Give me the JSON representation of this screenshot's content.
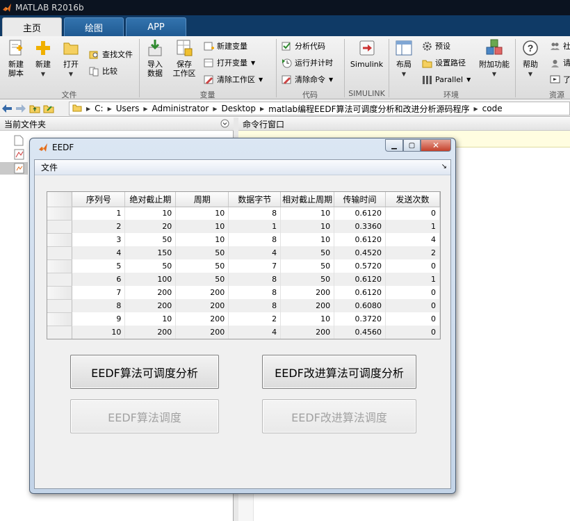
{
  "app": {
    "title": "MATLAB R2016b"
  },
  "tabs": [
    {
      "label": "主页",
      "active": true
    },
    {
      "label": "绘图",
      "active": false
    },
    {
      "label": "APP",
      "active": false
    }
  ],
  "ribbon": {
    "file": {
      "label": "文件",
      "new_script": "新建\n脚本",
      "new": "新建",
      "open": "打开",
      "find_files": "查找文件",
      "compare": "比较"
    },
    "variable": {
      "label": "变量",
      "import_data": "导入\n数据",
      "save_workspace": "保存\n工作区",
      "new_variable": "新建变量",
      "open_variable": "打开变量",
      "clear_workspace": "清除工作区"
    },
    "code": {
      "label": "代码",
      "analyze_code": "分析代码",
      "run_and_time": "运行并计时",
      "clear_commands": "清除命令"
    },
    "simulink": {
      "label": "SIMULINK",
      "simulink": "Simulink"
    },
    "environment": {
      "label": "环境",
      "layout": "布局",
      "preferences": "预设",
      "set_path": "设置路径",
      "parallel": "Parallel",
      "add_ons": "附加功能"
    },
    "resources": {
      "label": "资源",
      "help": "帮助",
      "community": "社",
      "request": "请",
      "learn": "了"
    }
  },
  "address": {
    "crumbs": [
      "C:",
      "Users",
      "Administrator",
      "Desktop",
      "matlab编程EEDF算法可调度分析和改进分析源码程序",
      "code"
    ]
  },
  "panels": {
    "current_folder": "当前文件夹",
    "command_window": "命令行窗口"
  },
  "dialog": {
    "title": "EEDF",
    "menu_file": "文件",
    "table": {
      "columns": [
        "序列号",
        "绝对截止期",
        "周期",
        "数据字节",
        "相对截止周期",
        "传输时间",
        "发送次数"
      ],
      "rows": [
        [
          "1",
          "10",
          "10",
          "8",
          "10",
          "0.6120",
          "0"
        ],
        [
          "2",
          "20",
          "10",
          "1",
          "10",
          "0.3360",
          "1"
        ],
        [
          "3",
          "50",
          "10",
          "8",
          "10",
          "0.6120",
          "4"
        ],
        [
          "4",
          "150",
          "50",
          "4",
          "50",
          "0.4520",
          "2"
        ],
        [
          "5",
          "50",
          "50",
          "7",
          "50",
          "0.5720",
          "0"
        ],
        [
          "6",
          "100",
          "50",
          "8",
          "50",
          "0.6120",
          "1"
        ],
        [
          "7",
          "200",
          "200",
          "8",
          "200",
          "0.6120",
          "0"
        ],
        [
          "8",
          "200",
          "200",
          "8",
          "200",
          "0.6080",
          "0"
        ],
        [
          "9",
          "10",
          "200",
          "2",
          "10",
          "0.3720",
          "0"
        ],
        [
          "10",
          "200",
          "200",
          "4",
          "200",
          "0.4560",
          "0"
        ]
      ]
    },
    "buttons": {
      "eedf_analysis": "EEDF算法可调度分析",
      "eedf_improved_analysis": "EEDF改进算法可调度分析",
      "eedf_schedule": "EEDF算法调度",
      "eedf_improved_schedule": "EEDF改进算法调度"
    }
  },
  "icons": {
    "back": "back-arrow-icon",
    "forward": "forward-arrow-icon",
    "up": "up-folder-icon",
    "browse": "browse-folder-icon"
  },
  "colors": {
    "titlebar": "#0b1320",
    "tabstrip": "#0f3a66",
    "close_button": "#c4412b"
  }
}
